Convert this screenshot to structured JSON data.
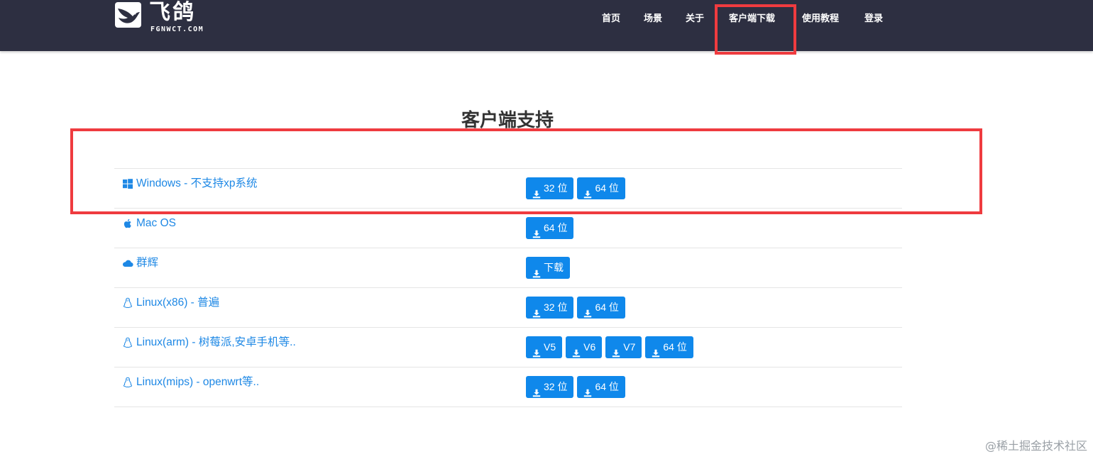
{
  "site": {
    "logo_text": "飞鸽",
    "logo_domain": "FGNWCT.COM"
  },
  "nav": {
    "items": [
      {
        "label": "首页"
      },
      {
        "label": "场景"
      },
      {
        "label": "关于"
      },
      {
        "label": "客户端下载"
      },
      {
        "label": "使用教程"
      },
      {
        "label": "登录"
      }
    ]
  },
  "section": {
    "title": "客户端支持"
  },
  "clients": [
    {
      "icon": "windows-icon",
      "label": "Windows - 不支持xp系统",
      "buttons": [
        "32 位",
        "64 位"
      ]
    },
    {
      "icon": "apple-icon",
      "label": "Mac OS",
      "buttons": [
        "64 位"
      ]
    },
    {
      "icon": "cloud-icon",
      "label": "群辉",
      "buttons": [
        "下载"
      ]
    },
    {
      "icon": "linux-icon",
      "label": "Linux(x86) - 普遍",
      "buttons": [
        "32 位",
        "64 位"
      ]
    },
    {
      "icon": "linux-icon",
      "label": "Linux(arm) - 树莓派,安卓手机等..",
      "buttons": [
        "V5",
        "V6",
        "V7",
        "64 位"
      ]
    },
    {
      "icon": "linux-icon",
      "label": "Linux(mips) - openwrt等..",
      "buttons": [
        "32 位",
        "64 位"
      ]
    }
  ],
  "watermark": "@稀土掘金技术社区",
  "colors": {
    "navbar_bg": "#2d2f41",
    "link": "#1e88e5",
    "button": "#0f88eb",
    "highlight": "#ef3b3f"
  }
}
